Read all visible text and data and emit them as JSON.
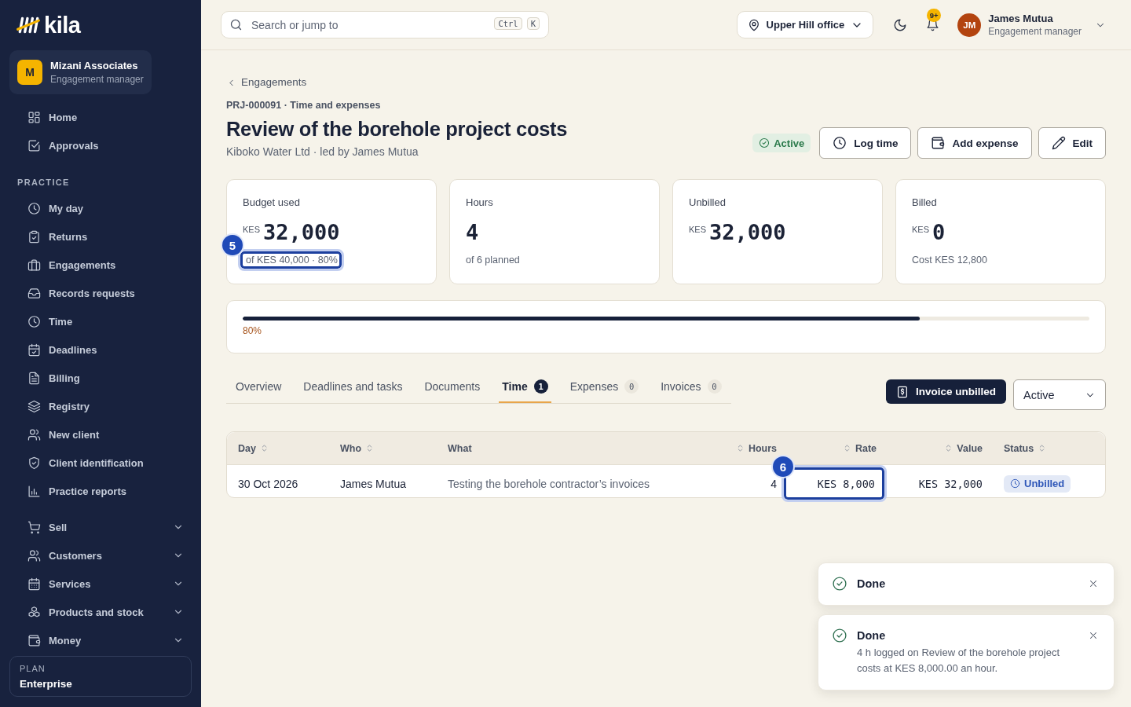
{
  "sidebar": {
    "logo": "kila",
    "org": {
      "initial": "M",
      "name": "Mizani Associates",
      "role": "Engagement manager"
    },
    "nav": [
      {
        "label": "Home",
        "selected": false
      },
      {
        "label": "Approvals",
        "selected": false
      }
    ],
    "sections": [
      {
        "title": "PRACTICE",
        "items": [
          {
            "label": "My day",
            "selected": false
          },
          {
            "label": "Returns",
            "selected": false
          },
          {
            "label": "Engagements",
            "selected": false
          },
          {
            "label": "Records requests",
            "selected": false
          },
          {
            "label": "Time",
            "selected": false
          },
          {
            "label": "Deadlines",
            "selected": false
          },
          {
            "label": "Billing",
            "selected": false
          },
          {
            "label": "Registry",
            "selected": false
          },
          {
            "label": "New client",
            "selected": false
          },
          {
            "label": "Client identification",
            "selected": false
          },
          {
            "label": "Practice reports",
            "selected": false
          }
        ]
      },
      {
        "items": [
          {
            "label": "Sell",
            "selected": false,
            "expanded": false
          },
          {
            "label": "Customers",
            "selected": false,
            "expanded": false
          },
          {
            "label": "Services",
            "selected": false,
            "expanded": false
          },
          {
            "label": "Products and stock",
            "selected": false,
            "expanded": false
          },
          {
            "label": "Money",
            "selected": false,
            "expanded": false
          }
        ]
      }
    ],
    "plan": {
      "label": "PLAN",
      "name": "Enterprise"
    }
  },
  "topbar": {
    "search": {
      "placeholder": "Search or jump to",
      "shortcut": [
        "Ctrl",
        "K"
      ]
    },
    "location": "Upper Hill office",
    "notifications": "9+",
    "user": {
      "initials": "JM",
      "name": "James Mutua",
      "role": "Engagement manager"
    }
  },
  "header": {
    "back": "Engagements",
    "eyebrow": "PRJ-000091 · Time and expenses",
    "title": "Review of the borehole project costs",
    "subtitle": "Kiboko Water Ltd · led by James Mutua",
    "status": "Active",
    "actions": [
      "Log time",
      "Add expense",
      "Edit"
    ]
  },
  "metrics": [
    {
      "label": "Budget used",
      "currency": "KES",
      "value": "32,000",
      "note": "of KES 40,000 · 80%",
      "callout": "5"
    },
    {
      "label": "Hours",
      "value": "4",
      "note": "of 6 planned"
    },
    {
      "label": "Unbilled",
      "currency": "KES",
      "value": "32,000"
    },
    {
      "label": "Billed",
      "currency": "KES",
      "value": "0",
      "note": "Cost KES 12,800"
    }
  ],
  "progress": {
    "level": 0.8,
    "label": "80%"
  },
  "tabs": [
    {
      "label": "Overview",
      "selected": false
    },
    {
      "label": "Deadlines and tasks",
      "selected": false
    },
    {
      "label": "Documents",
      "selected": false
    },
    {
      "label": "Time",
      "count": "1",
      "selected": true
    },
    {
      "label": "Expenses",
      "count": "0",
      "selected": false
    },
    {
      "label": "Invoices",
      "count": "0",
      "selected": false
    }
  ],
  "toolbar": {
    "button": "Invoice unbilled",
    "filter": "Active"
  },
  "table": {
    "columns": [
      {
        "label": "Day",
        "sortable": true
      },
      {
        "label": "Who",
        "sortable": true
      },
      {
        "label": "What",
        "sortable": false
      },
      {
        "label": "Hours",
        "sortable": true
      },
      {
        "label": "Rate",
        "sortable": true
      },
      {
        "label": "Value",
        "sortable": true
      },
      {
        "label": "Status",
        "sortable": true
      }
    ],
    "rows": [
      {
        "cells": [
          {
            "kind": "text",
            "text": "30 Oct 2026"
          },
          {
            "kind": "text",
            "text": "James Mutua"
          },
          {
            "kind": "muted",
            "text": "Testing the borehole contractor’s invoices"
          },
          {
            "kind": "text",
            "text": "4"
          },
          {
            "kind": "money",
            "text": "KES 8,000",
            "callout": "6"
          },
          {
            "kind": "money",
            "text": "KES 32,000"
          },
          {
            "kind": "status",
            "text": "Unbilled"
          }
        ]
      }
    ]
  },
  "toasts": [
    {
      "title": "Done"
    },
    {
      "title": "Done",
      "message": "4 h logged on Review of the borehole project costs at KES 8,000.00 an hour."
    }
  ]
}
